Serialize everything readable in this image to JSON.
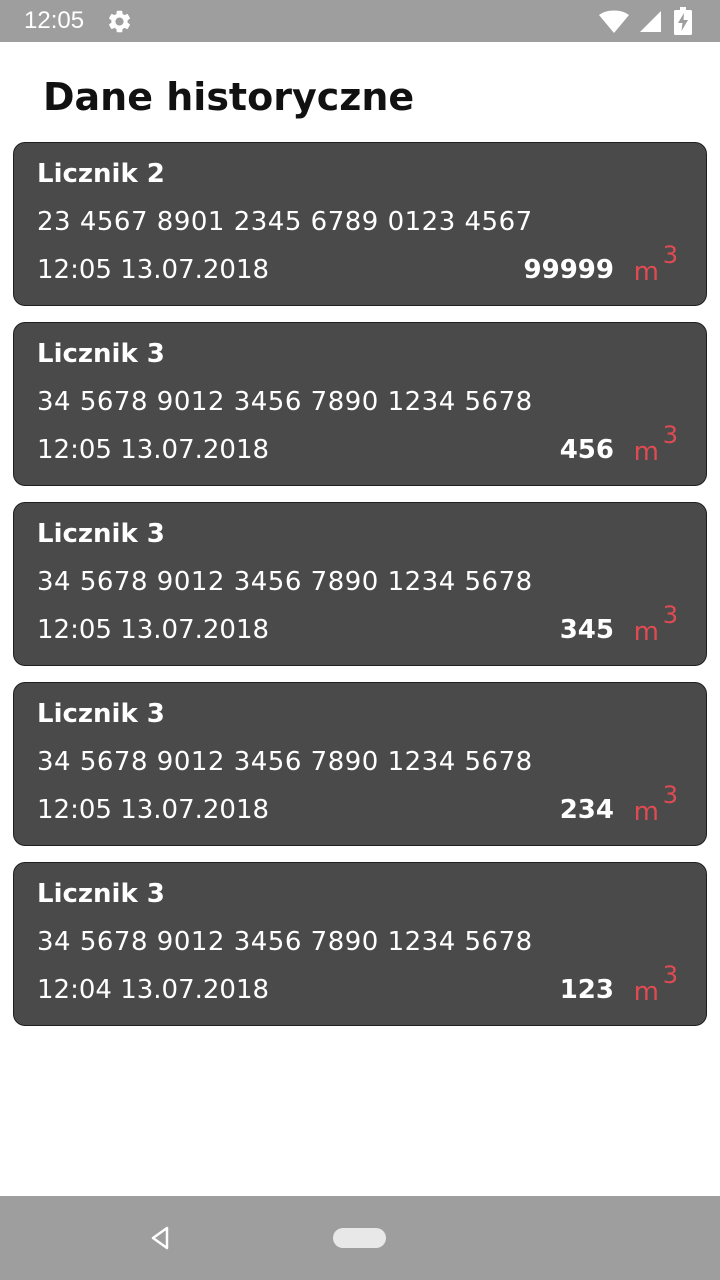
{
  "status_bar": {
    "time": "12:05",
    "icons": [
      "gear-icon",
      "wifi-icon",
      "signal-icon",
      "battery-charging-icon"
    ]
  },
  "header": {
    "title": "Dane historyczne"
  },
  "readings": [
    {
      "name": "Licznik 2",
      "serial": "23 4567 8901 2345 6789 0123 4567",
      "datetime": "12:05 13.07.2018",
      "value": "99999",
      "unit": "m",
      "unit_exponent": "3"
    },
    {
      "name": "Licznik 3",
      "serial": "34 5678 9012 3456 7890 1234 5678",
      "datetime": "12:05 13.07.2018",
      "value": "456",
      "unit": "m",
      "unit_exponent": "3"
    },
    {
      "name": "Licznik 3",
      "serial": "34 5678 9012 3456 7890 1234 5678",
      "datetime": "12:05 13.07.2018",
      "value": "345",
      "unit": "m",
      "unit_exponent": "3"
    },
    {
      "name": "Licznik 3",
      "serial": "34 5678 9012 3456 7890 1234 5678",
      "datetime": "12:05 13.07.2018",
      "value": "234",
      "unit": "m",
      "unit_exponent": "3"
    },
    {
      "name": "Licznik 3",
      "serial": "34 5678 9012 3456 7890 1234 5678",
      "datetime": "12:04 13.07.2018",
      "value": "123",
      "unit": "m",
      "unit_exponent": "3"
    }
  ],
  "nav_bar": {
    "icons": [
      "back-icon",
      "home-pill-icon"
    ]
  },
  "colors": {
    "card_background": "#4a4a4a",
    "unit_accent": "#e04b53",
    "system_bar": "#9e9e9e"
  }
}
